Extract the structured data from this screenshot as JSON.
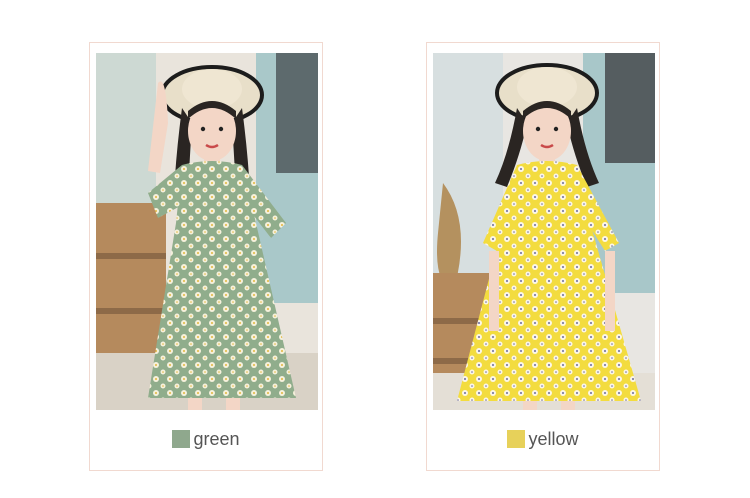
{
  "products": [
    {
      "color_name": "green",
      "swatch_color": "#8fa88d",
      "dress_color": "#90ad8c",
      "icon": "green-dress-photo"
    },
    {
      "color_name": "yellow",
      "swatch_color": "#e7d15a",
      "dress_color": "#f3dc3f",
      "icon": "yellow-dress-photo"
    }
  ]
}
